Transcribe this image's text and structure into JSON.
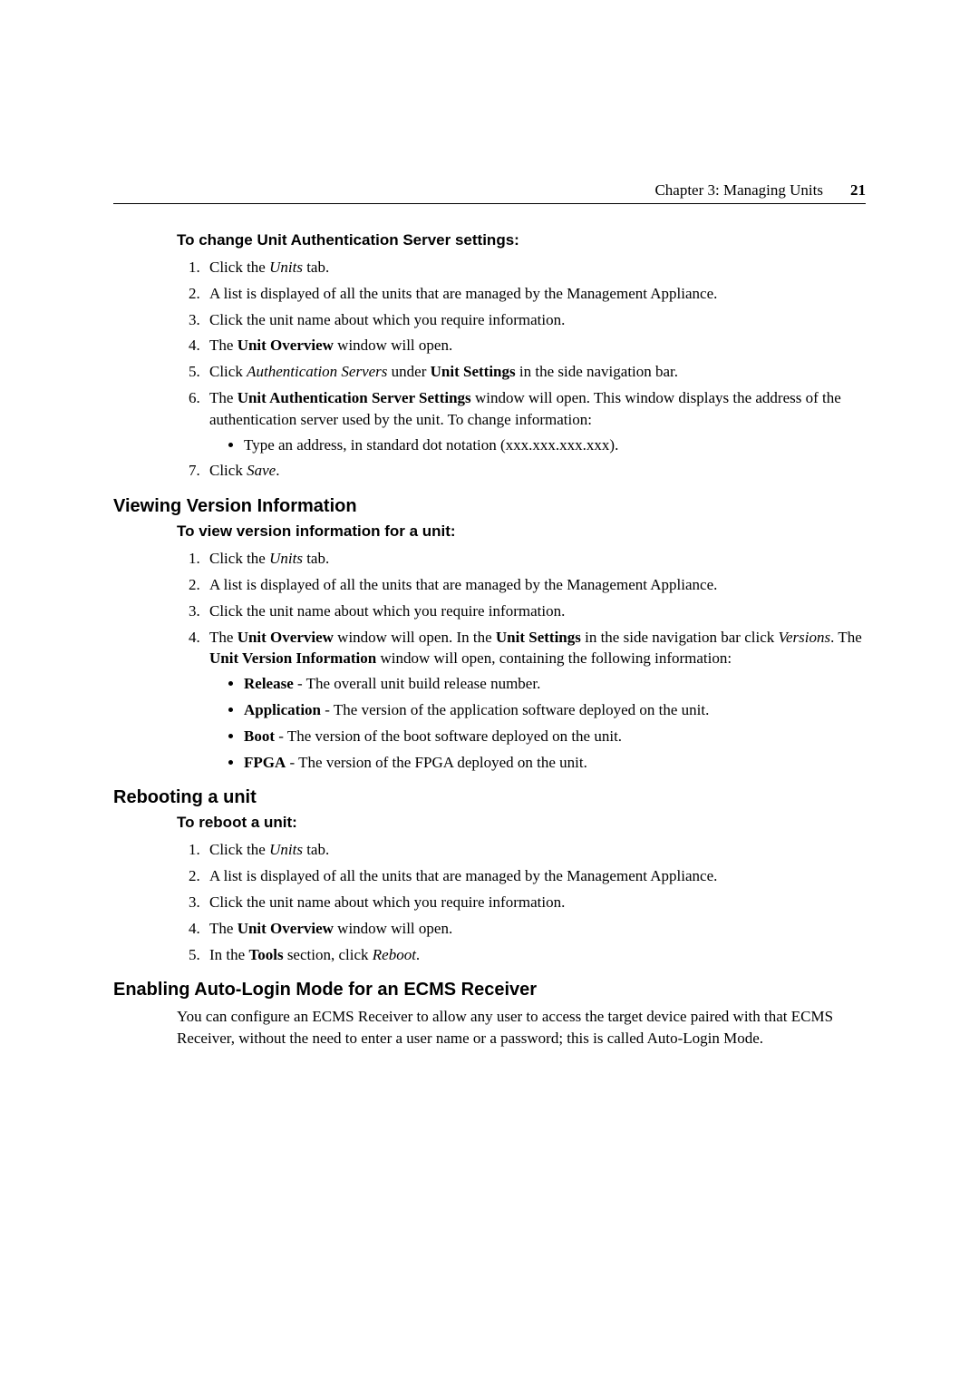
{
  "header": {
    "chapter": "Chapter 3: Managing Units",
    "page": "21"
  },
  "sec_auth": {
    "title": "To change Unit Authentication Server settings:",
    "s1_a": "Click the ",
    "s1_b": "Units",
    "s1_c": " tab.",
    "s2": "A list is displayed of all the units that are managed by the Management Appliance.",
    "s3": "Click the unit name about which you require information.",
    "s4_a": "The ",
    "s4_b": "Unit Overview",
    "s4_c": " window will open.",
    "s5_a": "Click ",
    "s5_b": "Authentication Servers",
    "s5_c": " under ",
    "s5_d": "Unit Settings",
    "s5_e": " in the side navigation bar.",
    "s6_a": "The ",
    "s6_b": "Unit Authentication Server Settings",
    "s6_c": " window will open. This window displays the address of the authentication server used by the unit. To change information:",
    "s6_bullet": "Type an address, in standard dot notation (xxx.xxx.xxx.xxx).",
    "s7_a": "Click ",
    "s7_b": "Save",
    "s7_c": "."
  },
  "sec_version": {
    "heading": "Viewing Version Information",
    "title": "To view version information for a unit:",
    "s1_a": "Click the ",
    "s1_b": "Units",
    "s1_c": " tab.",
    "s2": "A list is displayed of all the units that are managed by the Management Appliance.",
    "s3": "Click the unit name about which you require information.",
    "s4_a": "The ",
    "s4_b": "Unit Overview",
    "s4_c": " window will open. In the ",
    "s4_d": "Unit Settings",
    "s4_e": " in the side navigation bar click ",
    "s4_f": "Versions",
    "s4_g": ". The ",
    "s4_h": "Unit Version Information",
    "s4_i": " window will open, containing the following information:",
    "b1_a": "Release",
    "b1_b": " - The overall unit build release number.",
    "b2_a": "Application",
    "b2_b": " - The version of the application software deployed on the unit.",
    "b3_a": "Boot",
    "b3_b": " - The version of the boot software deployed on the unit.",
    "b4_a": "FPGA",
    "b4_b": " - The version of the FPGA deployed on the unit."
  },
  "sec_reboot": {
    "heading": "Rebooting a unit",
    "title": "To reboot a unit:",
    "s1_a": "Click the ",
    "s1_b": "Units",
    "s1_c": " tab.",
    "s2": "A list is displayed of all the units that are managed by the Management Appliance.",
    "s3": "Click the unit name about which you require information.",
    "s4_a": "The ",
    "s4_b": "Unit Overview",
    "s4_c": " window will open.",
    "s5_a": "In the ",
    "s5_b": "Tools",
    "s5_c": " section, click ",
    "s5_d": "Reboot",
    "s5_e": "."
  },
  "sec_autologin": {
    "heading": "Enabling Auto-Login Mode for an ECMS Receiver",
    "body": "You can configure an ECMS Receiver to allow any user to access the target device paired with that ECMS Receiver, without the need to enter a user name or a password; this is called Auto-Login Mode."
  }
}
